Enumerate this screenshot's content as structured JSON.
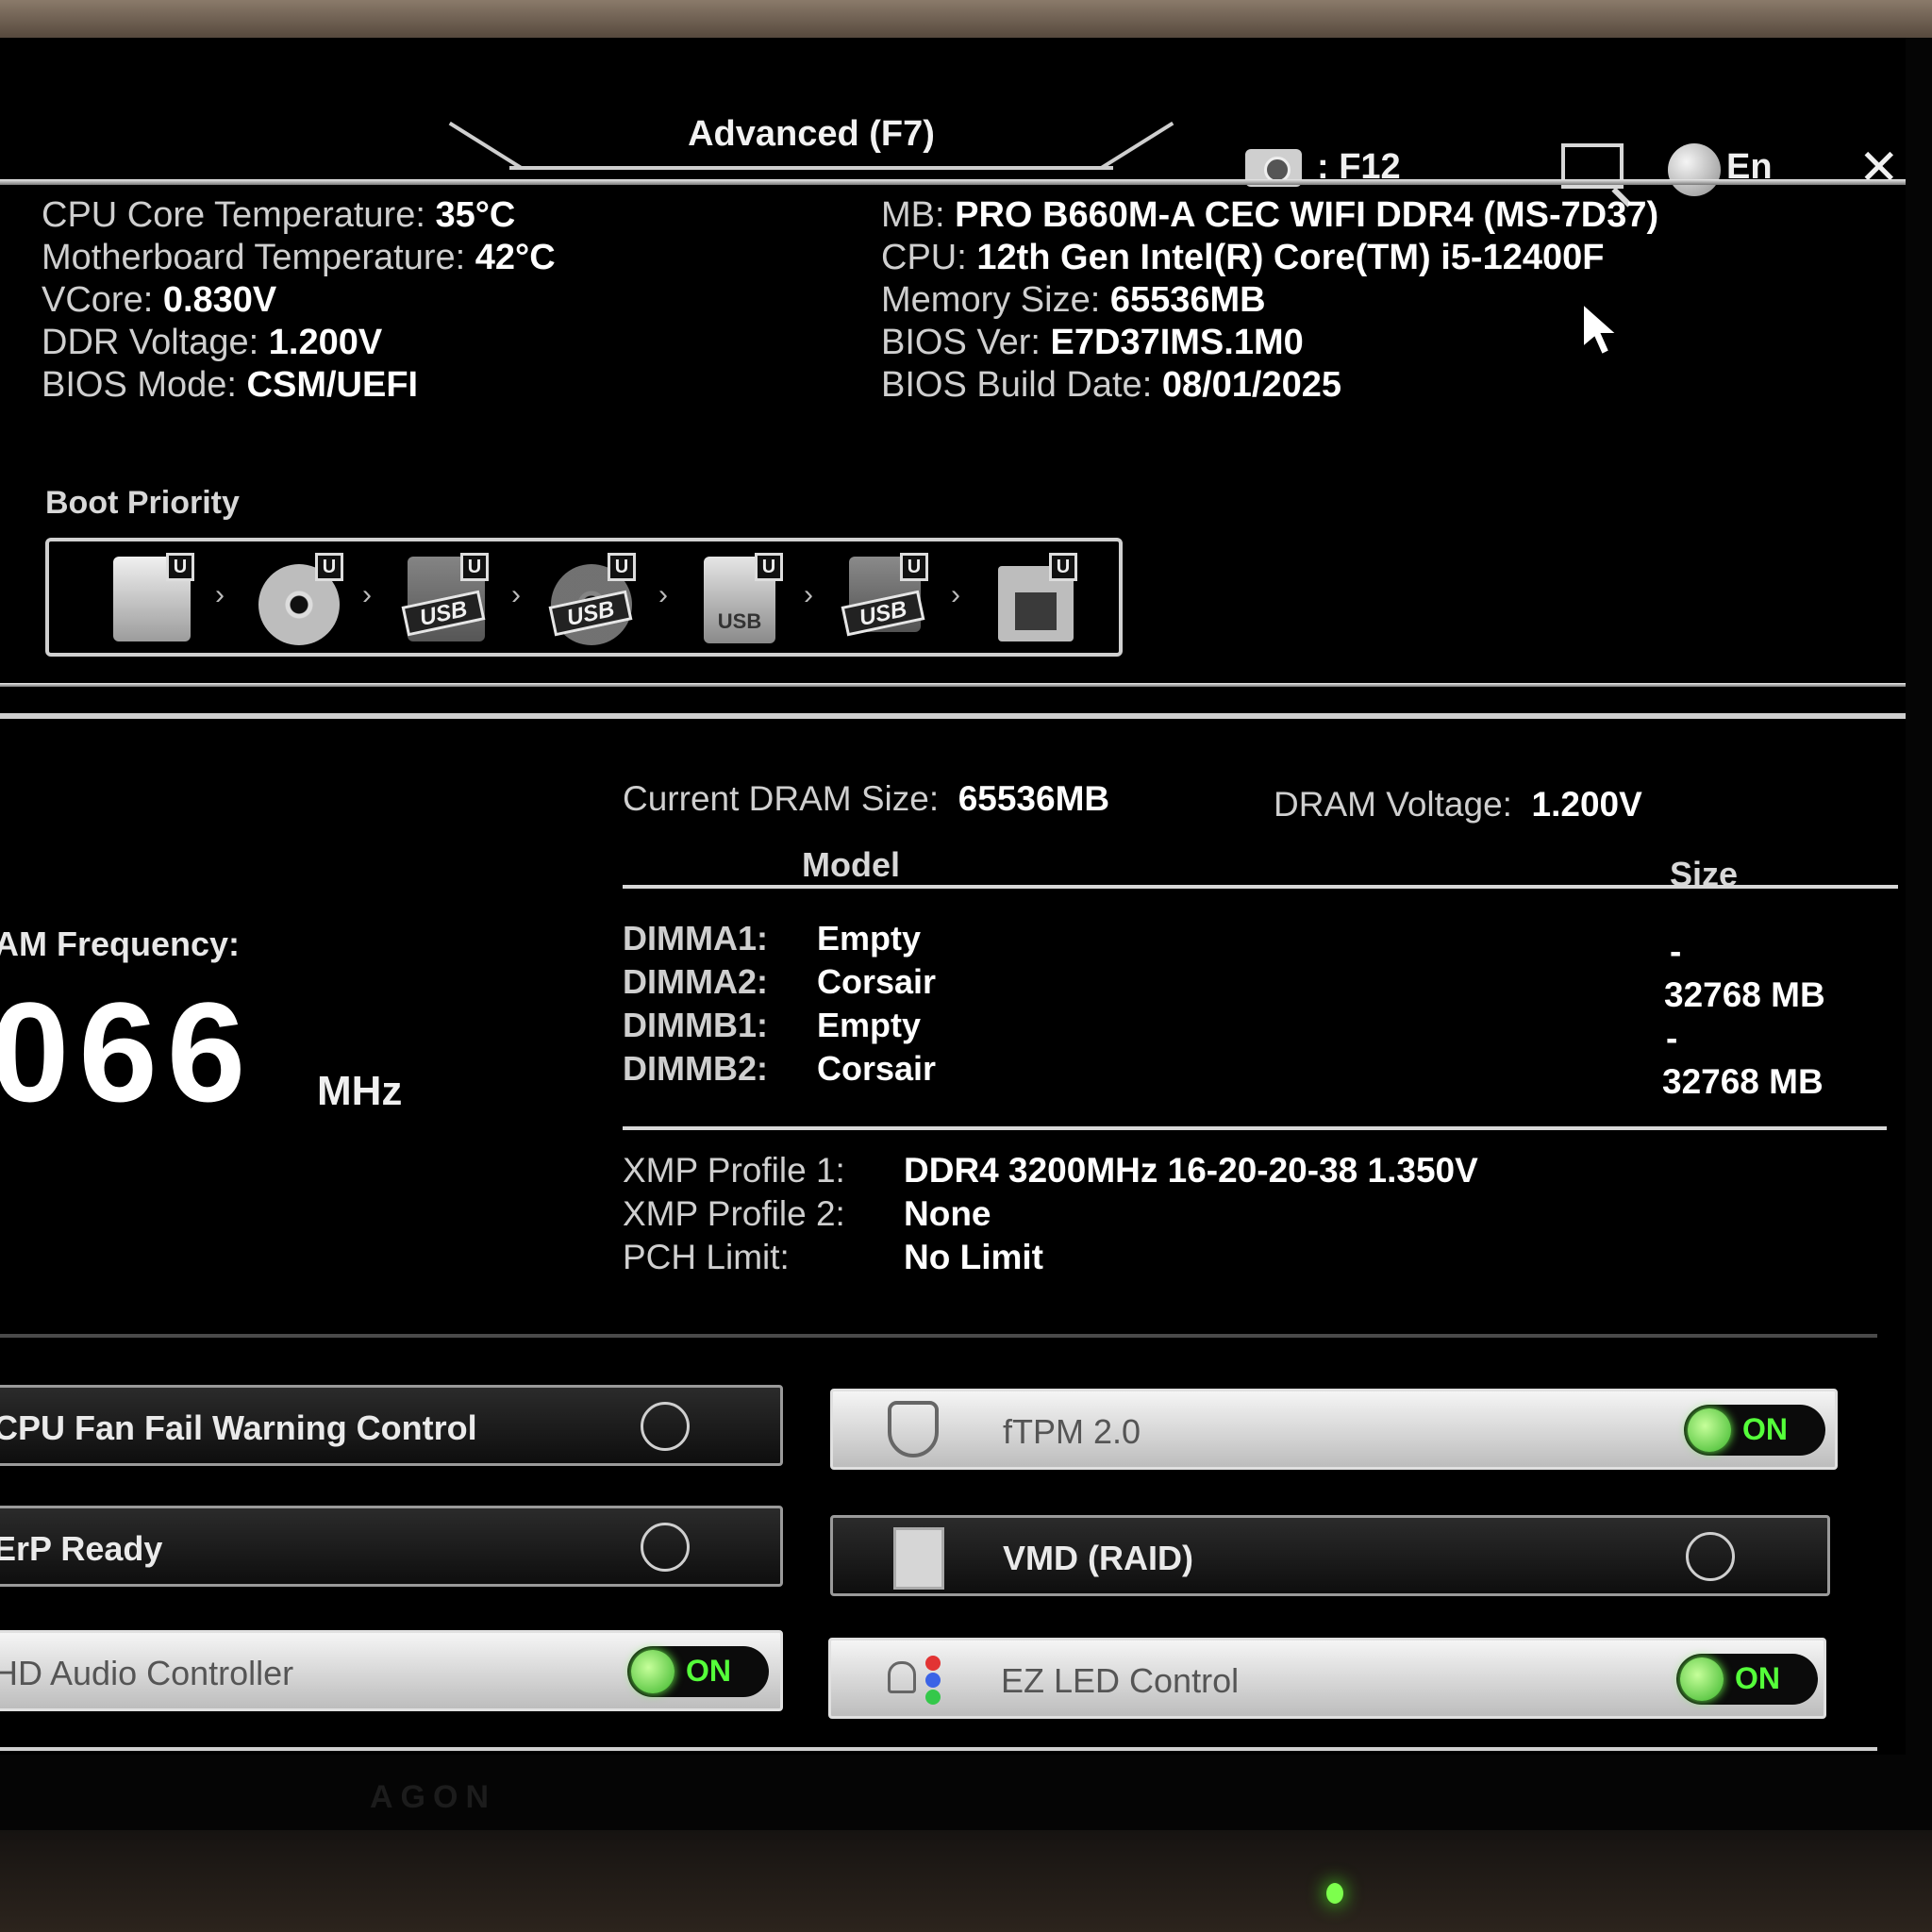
{
  "topbar": {
    "mode_tab": "Advanced (F7)",
    "screenshot_key": ": F12",
    "language": "En",
    "close": "✕"
  },
  "system": {
    "left": [
      {
        "label": "CPU Core Temperature:",
        "value": "35°C"
      },
      {
        "label": "Motherboard Temperature:",
        "value": "42°C"
      },
      {
        "label": "VCore:",
        "value": "0.830V"
      },
      {
        "label": "DDR Voltage:",
        "value": "1.200V"
      },
      {
        "label": "BIOS Mode:",
        "value": "CSM/UEFI"
      }
    ],
    "right": [
      {
        "label": "MB:",
        "value": "PRO B660M-A CEC WIFI DDR4 (MS-7D37)"
      },
      {
        "label": "CPU:",
        "value": "12th Gen Intel(R) Core(TM) i5-12400F"
      },
      {
        "label": "Memory Size:",
        "value": "65536MB"
      },
      {
        "label": "BIOS Ver:",
        "value": "E7D37IMS.1M0"
      },
      {
        "label": "BIOS Build Date:",
        "value": "08/01/2025"
      }
    ]
  },
  "boot": {
    "title": "Boot Priority",
    "badge": "U",
    "arrow": "›",
    "usb_tag": "USB",
    "devices": [
      {
        "icon": "hard-drive-icon"
      },
      {
        "icon": "optical-disc-icon"
      },
      {
        "icon": "usb-hard-drive-icon"
      },
      {
        "icon": "usb-optical-disc-icon"
      },
      {
        "icon": "usb-stick-icon"
      },
      {
        "icon": "usb-floppy-icon"
      },
      {
        "icon": "network-icon"
      }
    ]
  },
  "memory": {
    "freq_label": "AM Frequency:",
    "freq_value": "066",
    "freq_unit": "MHz",
    "current_label": "Current DRAM Size:",
    "current_value": "65536MB",
    "voltage_label": "DRAM Voltage:",
    "voltage_value": "1.200V",
    "col_model": "Model",
    "col_size": "Size",
    "slots": [
      {
        "slot": "DIMMA1:",
        "model": "Empty",
        "size": "-"
      },
      {
        "slot": "DIMMA2:",
        "model": "Corsair",
        "size": "32768 MB"
      },
      {
        "slot": "DIMMB1:",
        "model": "Empty",
        "size": "-"
      },
      {
        "slot": "DIMMB2:",
        "model": "Corsair",
        "size": "32768 MB"
      }
    ],
    "xmp1_label": "XMP Profile 1:",
    "xmp1_value": "DDR4 3200MHz 16-20-20-38 1.350V",
    "xmp2_label": "XMP Profile 2:",
    "xmp2_value": "None",
    "pch_label": "PCH Limit:",
    "pch_value": "No Limit"
  },
  "toggles": {
    "on_text": "ON",
    "cpu_fan": {
      "label": "CPU Fan Fail Warning Control",
      "state": "off"
    },
    "erp": {
      "label": "ErP Ready",
      "state": "off"
    },
    "hd_audio": {
      "label": "HD Audio Controller",
      "state": "on"
    },
    "ftpm": {
      "label": "fTPM 2.0",
      "state": "on"
    },
    "vmd": {
      "label": "VMD (RAID)",
      "state": "off"
    },
    "ez_led": {
      "label": "EZ LED Control",
      "state": "on"
    }
  },
  "bezel": {
    "brand": "AGON"
  }
}
